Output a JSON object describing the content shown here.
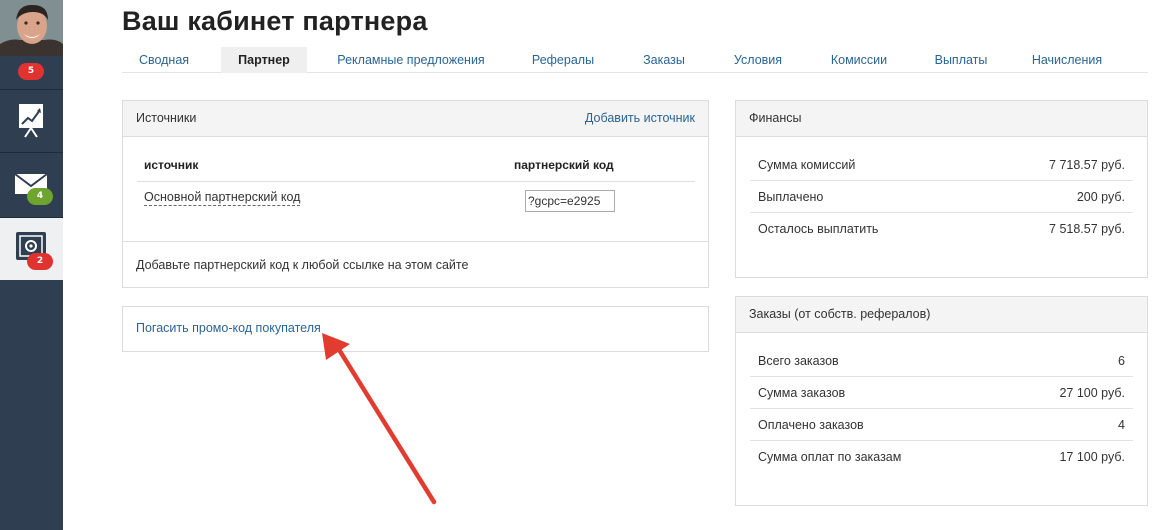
{
  "sidebar": {
    "avatar_badge": "5",
    "items": [
      {
        "icon": "chart-easel-icon",
        "badge": ""
      },
      {
        "icon": "envelope-icon",
        "badge": "4"
      },
      {
        "icon": "safe-settings-icon",
        "badge": "2"
      }
    ]
  },
  "header": {
    "title": "Ваш кабинет партнера"
  },
  "tabs": [
    {
      "label": "Сводная"
    },
    {
      "label": "Партнер"
    },
    {
      "label": "Рекламные предложения"
    },
    {
      "label": "Рефералы"
    },
    {
      "label": "Заказы"
    },
    {
      "label": "Условия"
    },
    {
      "label": "Комиссии"
    },
    {
      "label": "Выплаты"
    },
    {
      "label": "Начисления"
    }
  ],
  "sources": {
    "title": "Источники",
    "add_link": "Добавить источник",
    "col_source": "источник",
    "col_code": "партнерский код",
    "rows": [
      {
        "name": "Основной партнерский код",
        "code": "?gcpc=e2925"
      }
    ],
    "note": "Добавьте партнерский код к любой ссылке на этом сайте"
  },
  "promo": {
    "link": "Погасить промо-код покупателя"
  },
  "finance": {
    "title": "Финансы",
    "rows": [
      {
        "label": "Сумма комиссий",
        "value": "7 718.57 руб."
      },
      {
        "label": "Выплачено",
        "value": "200 руб."
      },
      {
        "label": "Осталось выплатить",
        "value": "7 518.57 руб."
      }
    ]
  },
  "orders": {
    "title": "Заказы (от собств. рефералов)",
    "rows": [
      {
        "label": "Всего заказов",
        "value": "6"
      },
      {
        "label": "Сумма заказов",
        "value": "27 100 руб."
      },
      {
        "label": "Оплачено заказов",
        "value": "4"
      },
      {
        "label": "Сумма оплат по заказам",
        "value": "17 100 руб."
      }
    ]
  },
  "colors": {
    "sidebar": "#2f3e51",
    "link": "#2a6496",
    "badge_red": "#e0332f",
    "badge_green": "#6ea52e",
    "arrow": "#e23c31"
  }
}
